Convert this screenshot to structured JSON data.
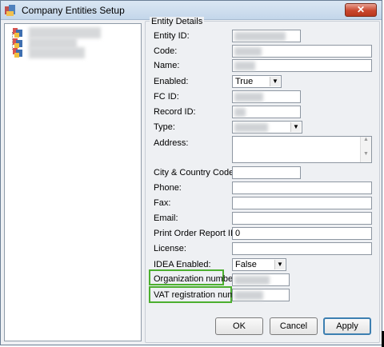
{
  "window": {
    "title": "Company Entities Setup",
    "close_glyph": "✕"
  },
  "tree": {
    "items": [
      {
        "icon": "entity-node-icon"
      },
      {
        "icon": "entity-node-icon"
      },
      {
        "icon": "entity-node-icon"
      }
    ]
  },
  "form": {
    "group_title": "Entity Details",
    "entity_id": {
      "label": "Entity ID:"
    },
    "code": {
      "label": "Code:"
    },
    "name": {
      "label": "Name:"
    },
    "enabled": {
      "label": "Enabled:",
      "value": "True"
    },
    "fc_id": {
      "label": "FC ID:"
    },
    "record_id": {
      "label": "Record ID:"
    },
    "type": {
      "label": "Type:"
    },
    "address": {
      "label": "Address:"
    },
    "city_country": {
      "label": "City & Country Code:"
    },
    "phone": {
      "label": "Phone:"
    },
    "fax": {
      "label": "Fax:"
    },
    "email": {
      "label": "Email:"
    },
    "print_order_report_id": {
      "label": "Print Order Report ID:",
      "value": "0"
    },
    "license": {
      "label": "License:"
    },
    "idea_enabled": {
      "label": "IDEA Enabled:",
      "value": "False"
    },
    "organization_number": {
      "label": "Organization number:"
    },
    "vat_registration_number": {
      "label": "VAT registration number:"
    }
  },
  "buttons": {
    "ok": "OK",
    "cancel": "Cancel",
    "apply": "Apply"
  },
  "colors": {
    "highlight": "#4caf2f",
    "close": "#c9472e"
  }
}
